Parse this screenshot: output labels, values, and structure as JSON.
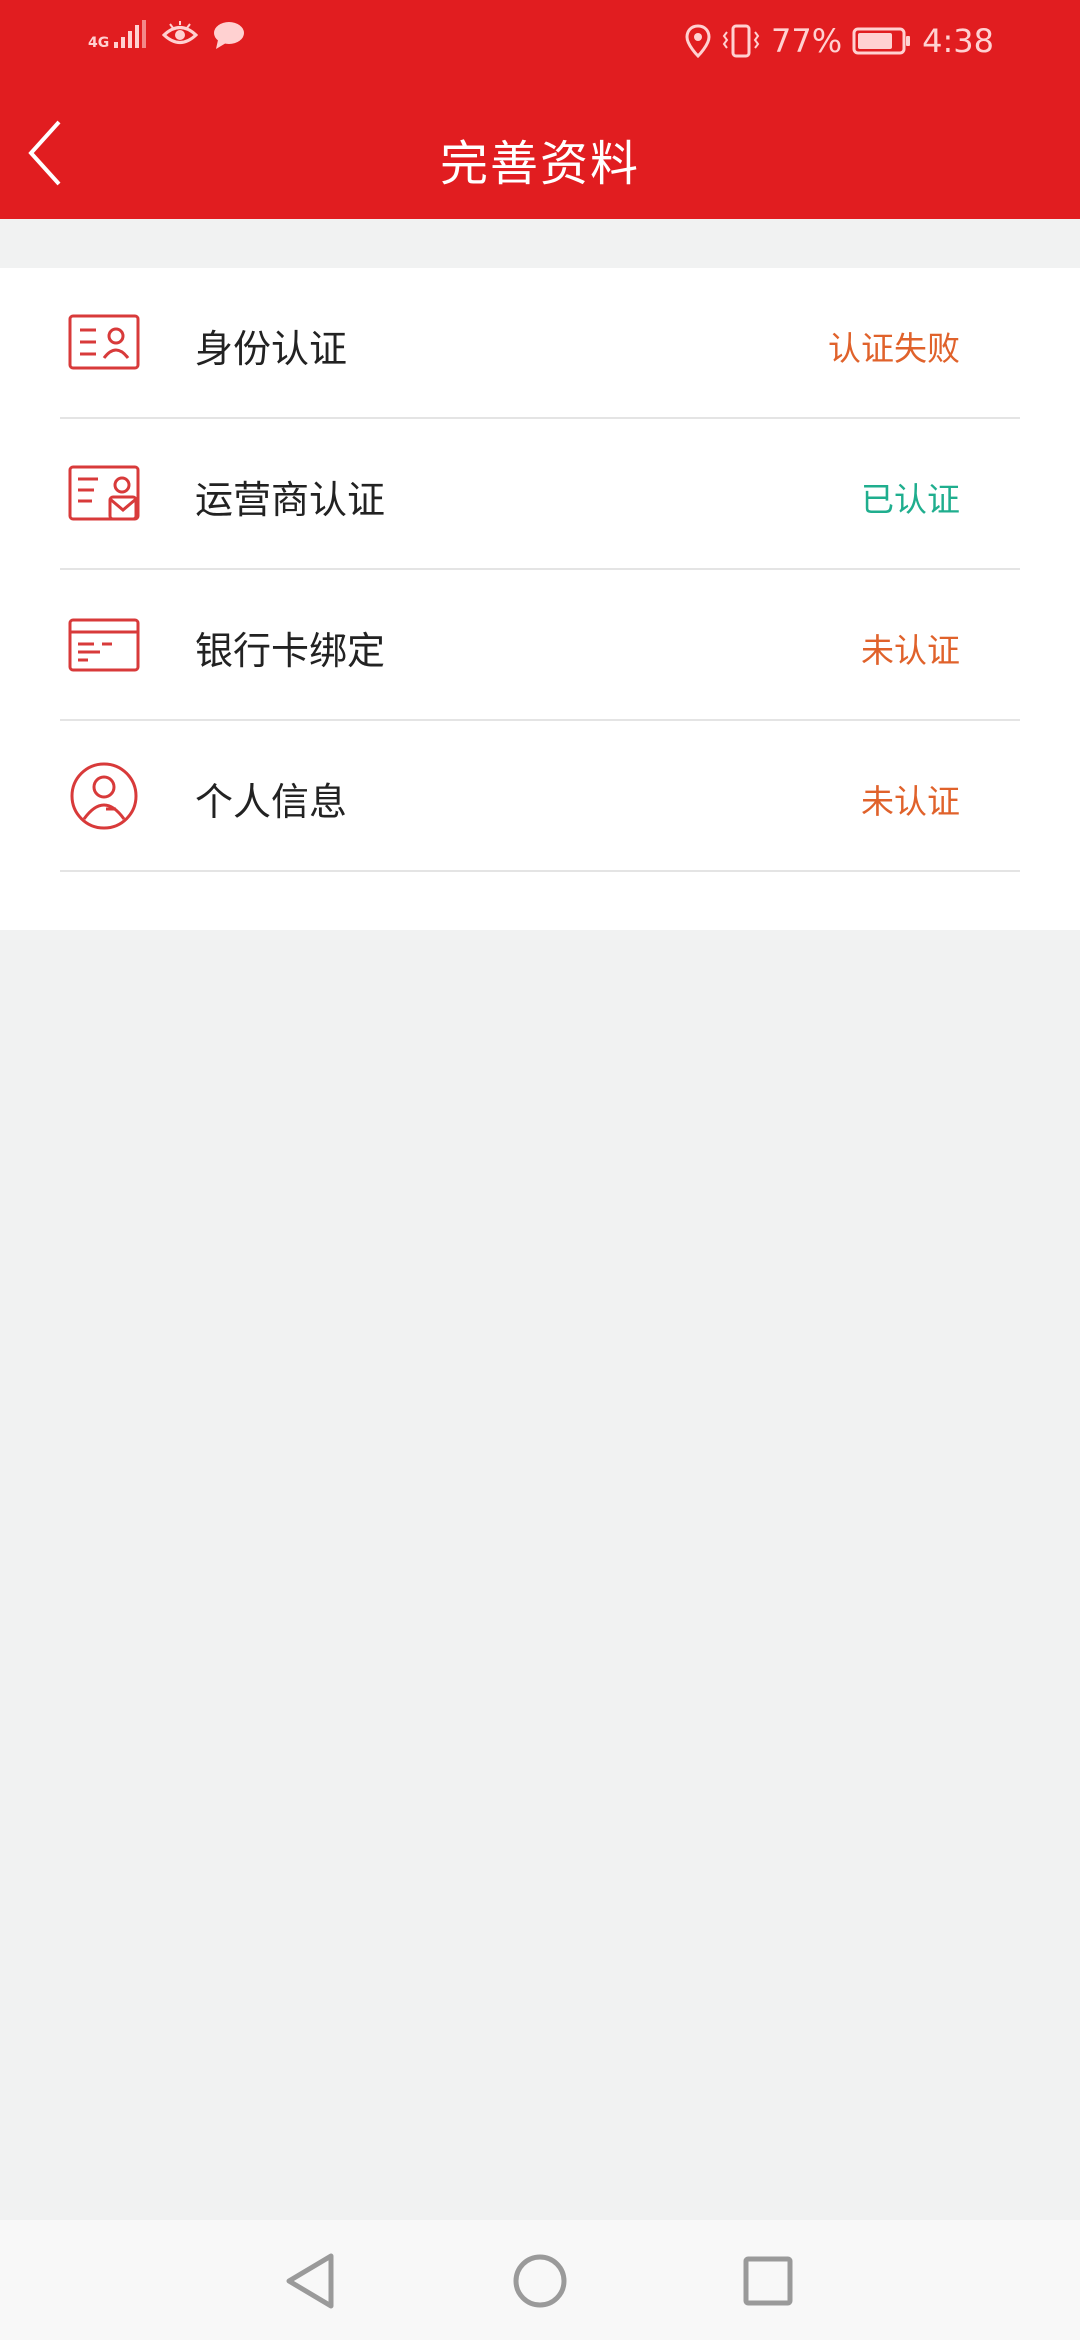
{
  "status_bar": {
    "network_label": "4G",
    "battery_percent": "77%",
    "time": "4:38",
    "icons": [
      "signal-icon",
      "eye-icon",
      "chat-icon",
      "location-icon",
      "vibrate-icon",
      "battery-icon"
    ]
  },
  "header": {
    "title": "完善资料",
    "back_icon": "chevron-left-icon"
  },
  "colors": {
    "brand_red": "#e11d20",
    "status_failed": "#e0622b",
    "status_verified": "#1fae8e",
    "status_unverified": "#e0622b",
    "icon_red": "#d83a3a"
  },
  "items": [
    {
      "label": "身份认证",
      "status": "认证失败",
      "icon": "id-card-icon"
    },
    {
      "label": "运营商认证",
      "status": "已认证",
      "icon": "carrier-card-icon"
    },
    {
      "label": "银行卡绑定",
      "status": "未认证",
      "icon": "bank-card-icon"
    },
    {
      "label": "个人信息",
      "status": "未认证",
      "icon": "user-circle-icon"
    }
  ],
  "navbar": {
    "icons": [
      "back-triangle-icon",
      "home-circle-icon",
      "recents-square-icon"
    ]
  }
}
